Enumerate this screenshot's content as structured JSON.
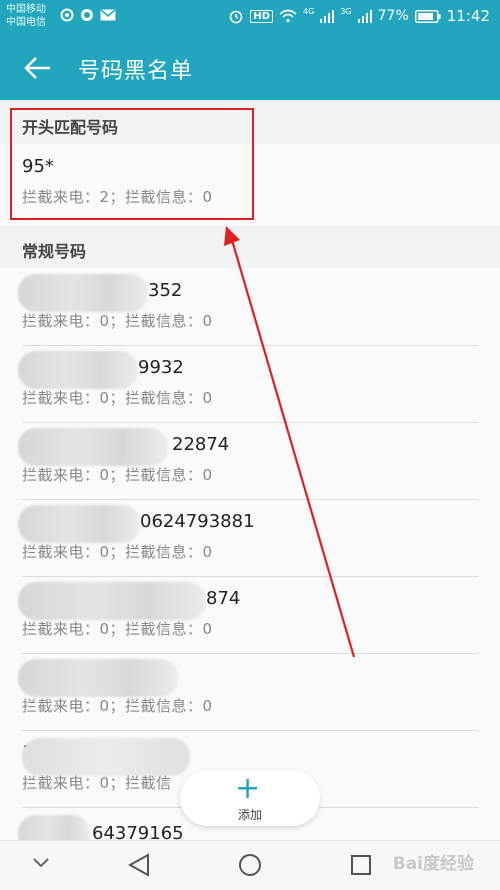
{
  "status_bar": {
    "carrier_1": "中国移动",
    "carrier_2": "中国电信",
    "network_1": "4G",
    "network_2": "3G",
    "battery": "77%",
    "time": "11:42",
    "hd_badge": "HD"
  },
  "app_bar": {
    "title": "号码黑名单",
    "back_icon": "arrow-left-icon"
  },
  "prefix_section": {
    "header": "开头匹配号码",
    "items": [
      {
        "number": "95*",
        "stats": "拦截来电：2；拦截信息：0"
      }
    ]
  },
  "regular_section": {
    "header": "常规号码",
    "items": [
      {
        "number": "352",
        "stats": "拦截来电：0；拦截信息：0"
      },
      {
        "number": "9932",
        "stats": "拦截来电：0；拦截信息：0"
      },
      {
        "number": "22874",
        "stats": "拦截来电：0；拦截信息：0"
      },
      {
        "number": "0624793881",
        "stats": "拦截来电：0；拦截信息：0"
      },
      {
        "number": "874",
        "stats": "拦截来电：0；拦截信息：0"
      },
      {
        "number": "",
        "stats": "拦截来电：0；拦截信息：0"
      },
      {
        "number": "1",
        "stats": "拦截来电：0；拦截信"
      },
      {
        "number": "64379165",
        "stats": ""
      }
    ]
  },
  "fab": {
    "label": "添加",
    "icon": "plus-icon"
  },
  "watermark": "Bai度经验",
  "colors": {
    "accent": "#21a6bd",
    "highlight": "#e02020"
  }
}
